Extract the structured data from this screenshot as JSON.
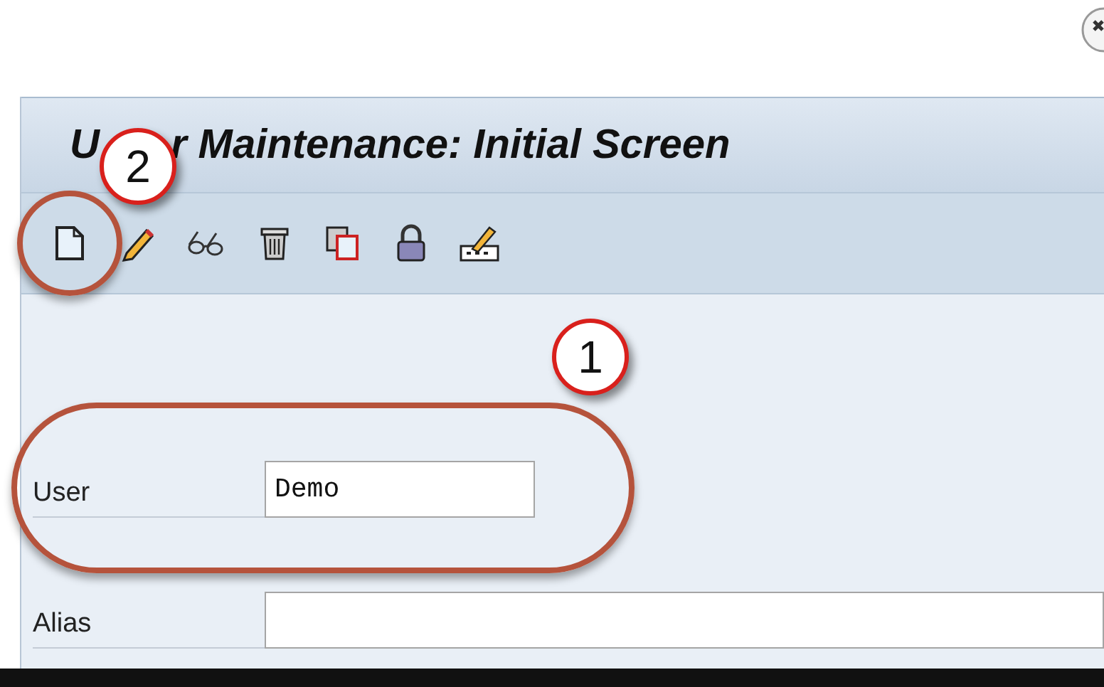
{
  "window": {
    "title_parts": [
      "U",
      "r Maintenance: Initial Screen"
    ]
  },
  "toolbar": [
    {
      "kind": "create"
    },
    {
      "kind": "change"
    },
    {
      "kind": "display"
    },
    {
      "kind": "delete"
    },
    {
      "kind": "copy"
    },
    {
      "kind": "lock"
    },
    {
      "kind": "password"
    }
  ],
  "fields": [
    {
      "label": "User",
      "value": "Demo"
    },
    {
      "label": "Alias"
    }
  ],
  "annotations": [
    {
      "number": "1"
    },
    {
      "number": "2"
    }
  ]
}
